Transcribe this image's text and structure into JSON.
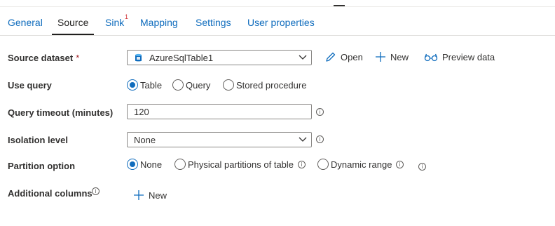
{
  "tabs": [
    {
      "label": "General"
    },
    {
      "label": "Source"
    },
    {
      "label": "Sink",
      "badge": "1"
    },
    {
      "label": "Mapping"
    },
    {
      "label": "Settings"
    },
    {
      "label": "User properties"
    }
  ],
  "source_dataset": {
    "label": "Source dataset",
    "required_mark": "*",
    "value": "AzureSqlTable1",
    "open_label": "Open",
    "new_label": "New",
    "preview_label": "Preview data"
  },
  "use_query": {
    "label": "Use query",
    "options": [
      "Table",
      "Query",
      "Stored procedure"
    ],
    "selected": "Table"
  },
  "query_timeout": {
    "label": "Query timeout (minutes)",
    "value": "120"
  },
  "isolation_level": {
    "label": "Isolation level",
    "value": "None"
  },
  "partition_option": {
    "label": "Partition option",
    "options": [
      "None",
      "Physical partitions of table",
      "Dynamic range"
    ],
    "selected": "None"
  },
  "additional_columns": {
    "label": "Additional columns",
    "new_label": "New"
  },
  "colors": {
    "accent": "#0f6cbd",
    "required": "#a4262c",
    "badge": "#d13438"
  }
}
